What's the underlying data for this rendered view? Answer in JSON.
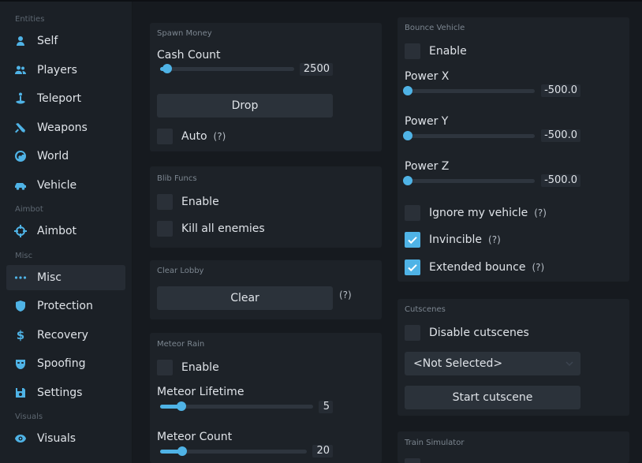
{
  "sidebar": {
    "sections": {
      "entities": "Entities",
      "aimbot": "Aimbot",
      "misc": "Misc",
      "visuals": "Visuals"
    },
    "items": {
      "self": "Self",
      "players": "Players",
      "teleport": "Teleport",
      "weapons": "Weapons",
      "world": "World",
      "vehicle": "Vehicle",
      "aimbot": "Aimbot",
      "misc": "Misc",
      "protection": "Protection",
      "recovery": "Recovery",
      "spoofing": "Spoofing",
      "settings": "Settings",
      "visuals": "Visuals"
    },
    "active": "misc",
    "accent_color": "#4fb3e6"
  },
  "spawn_money": {
    "title": "Spawn Money",
    "cash_label": "Cash Count",
    "cash_value": "2500",
    "cash_fraction": 0.05,
    "drop_label": "Drop",
    "auto_label": "Auto",
    "auto_checked": false,
    "help": "(?)"
  },
  "blib_funcs": {
    "title": "Blib Funcs",
    "enable_label": "Enable",
    "kill_label": "Kill all enemies"
  },
  "clear_lobby": {
    "title": "Clear Lobby",
    "clear_label": "Clear",
    "help": "(?)"
  },
  "meteor_rain": {
    "title": "Meteor Rain",
    "enable_label": "Enable",
    "lifetime_label": "Meteor Lifetime",
    "lifetime_value": "5",
    "lifetime_fraction": 0.14,
    "count_label": "Meteor Count",
    "count_value": "20",
    "count_fraction": 0.15
  },
  "bounce_vehicle": {
    "title": "Bounce Vehicle",
    "enable_label": "Enable",
    "power_x_label": "Power X",
    "power_x_value": "-500.0",
    "power_y_label": "Power Y",
    "power_y_value": "-500.0",
    "power_z_label": "Power Z",
    "power_z_value": "-500.0",
    "power_fraction": 0.0,
    "ignore_label": "Ignore my vehicle",
    "ignore_checked": false,
    "invincible_label": "Invincible",
    "invincible_checked": true,
    "extended_label": "Extended bounce",
    "extended_checked": true,
    "help": "(?)"
  },
  "cutscenes": {
    "title": "Cutscenes",
    "disable_label": "Disable cutscenes",
    "select_value": "<Not Selected>",
    "start_label": "Start cutscene"
  },
  "train_simulator": {
    "title": "Train Simulator"
  }
}
